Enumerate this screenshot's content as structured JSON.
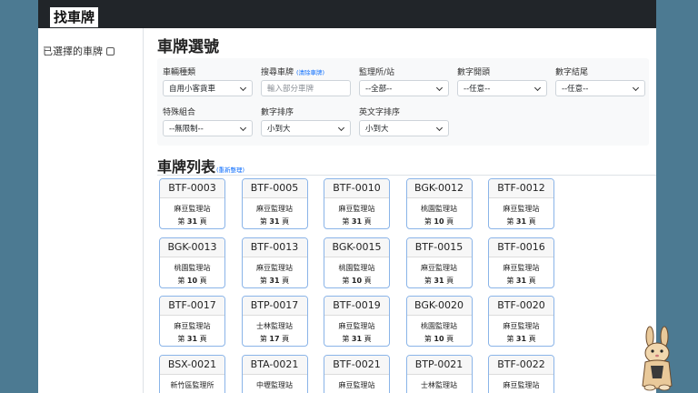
{
  "header": {
    "brand": "找車牌"
  },
  "sidebar": {
    "selected_title": "已選擇的車牌"
  },
  "page": {
    "title": "車牌選號"
  },
  "filters": {
    "vehicle_type": {
      "label": "車輛種類",
      "value": "自用小客貨車"
    },
    "search": {
      "label": "搜尋車牌",
      "clear_link": "(清除車牌)",
      "placeholder": "輸入部分車牌"
    },
    "station": {
      "label": "監理所/站",
      "value": "--全部--"
    },
    "prefix": {
      "label": "數字開頭",
      "value": "--任意--"
    },
    "suffix": {
      "label": "數字結尾",
      "value": "--任意--"
    },
    "special": {
      "label": "特殊組合",
      "value": "--無限制--"
    },
    "num_sort": {
      "label": "數字排序",
      "value": "小到大"
    },
    "alpha_sort": {
      "label": "英文字排序",
      "value": "小到大"
    }
  },
  "list": {
    "title": "車牌列表",
    "refresh_link": "(重新整理)",
    "page_prefix": "第",
    "page_suffix": "頁",
    "plates": [
      {
        "plate": "BTF-0003",
        "station": "麻豆監理站",
        "page": "31"
      },
      {
        "plate": "BTF-0005",
        "station": "麻豆監理站",
        "page": "31"
      },
      {
        "plate": "BTF-0010",
        "station": "麻豆監理站",
        "page": "31"
      },
      {
        "plate": "BGK-0012",
        "station": "桃園監理站",
        "page": "10"
      },
      {
        "plate": "BTF-0012",
        "station": "麻豆監理站",
        "page": "31"
      },
      {
        "plate": "BGK-0013",
        "station": "桃園監理站",
        "page": "10"
      },
      {
        "plate": "BTF-0013",
        "station": "麻豆監理站",
        "page": "31"
      },
      {
        "plate": "BGK-0015",
        "station": "桃園監理站",
        "page": "10"
      },
      {
        "plate": "BTF-0015",
        "station": "麻豆監理站",
        "page": "31"
      },
      {
        "plate": "BTF-0016",
        "station": "麻豆監理站",
        "page": "31"
      },
      {
        "plate": "BTF-0017",
        "station": "麻豆監理站",
        "page": "31"
      },
      {
        "plate": "BTP-0017",
        "station": "士林監理站",
        "page": "17"
      },
      {
        "plate": "BTF-0019",
        "station": "麻豆監理站",
        "page": "31"
      },
      {
        "plate": "BGK-0020",
        "station": "桃園監理站",
        "page": "10"
      },
      {
        "plate": "BTF-0020",
        "station": "麻豆監理站",
        "page": "31"
      },
      {
        "plate": "BSX-0021",
        "station": "新竹區監理所",
        "page": ""
      },
      {
        "plate": "BTA-0021",
        "station": "中壢監理站",
        "page": ""
      },
      {
        "plate": "BTF-0021",
        "station": "麻豆監理站",
        "page": ""
      },
      {
        "plate": "BTP-0021",
        "station": "士林監理站",
        "page": ""
      },
      {
        "plate": "BTF-0022",
        "station": "麻豆監理站",
        "page": ""
      }
    ]
  },
  "colors": {
    "topbar": "#212529",
    "card_border": "#8ab4e8",
    "link": "#0d6efd",
    "background": "#4c7a92"
  }
}
